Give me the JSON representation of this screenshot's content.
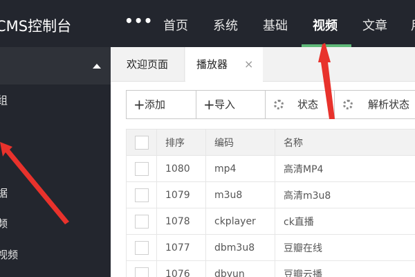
{
  "header": {
    "brand": "CMS控制台",
    "more_icon": "•••",
    "nav": [
      "首页",
      "系统",
      "基础",
      "视频",
      "文章",
      "用"
    ],
    "active_nav": "视频"
  },
  "sidebar": {
    "items": [
      "组",
      "据",
      "频",
      "视频"
    ]
  },
  "tabs": {
    "welcome": "欢迎页面",
    "player": "播放器",
    "close_icon": "×"
  },
  "toolbar": {
    "add_label": "添加",
    "import_label": "导入",
    "status_label": "状态",
    "parse_status_label": "解析状态"
  },
  "table": {
    "headers": [
      "排序",
      "编码",
      "名称"
    ],
    "rows": [
      {
        "sort": "1080",
        "code": "mp4",
        "name": "高清MP4"
      },
      {
        "sort": "1079",
        "code": "m3u8",
        "name": "高清m3u8"
      },
      {
        "sort": "1078",
        "code": "ckplayer",
        "name": "ck直播"
      },
      {
        "sort": "1077",
        "code": "dbm3u8",
        "name": "豆瓣在线"
      },
      {
        "sort": "1076",
        "code": "dbyun",
        "name": "豆瓣云播"
      }
    ]
  },
  "colors": {
    "topbar": "#23262e",
    "sidebar": "#23262e",
    "active_indicator": "#5fb878",
    "annotation_arrow": "#e8322c"
  },
  "icons": {
    "add": "plus-icon",
    "import": "plus-icon",
    "status": "gear-icon",
    "parse_status": "gear-icon",
    "sidebar_caret": "caret-up-icon",
    "tab_close": "close-icon"
  }
}
